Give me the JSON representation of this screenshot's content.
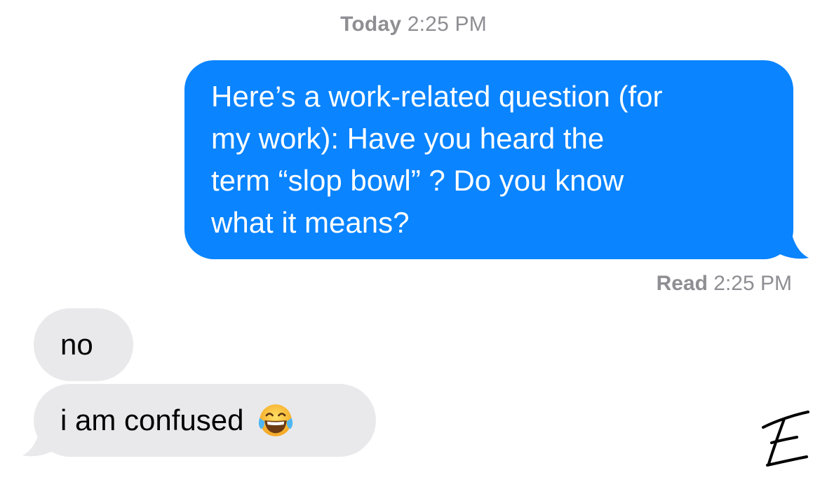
{
  "header": {
    "day": "Today",
    "time": "2:25 PM"
  },
  "messages": {
    "outgoing": {
      "text": "Here’s a work-related question (for my work): Have you heard the term “slop bowl” ? Do you know what it means?",
      "lines": [
        "Here’s a work-related question (for",
        "my work): Have you heard the",
        "term “slop bowl” ? Do you know",
        "what it means?"
      ]
    },
    "read_receipt": {
      "label": "Read",
      "time": "2:25 PM"
    },
    "incoming": [
      {
        "text": "no"
      },
      {
        "text": "i am confused",
        "emoji": "face-with-tears-of-joy-icon"
      }
    ]
  },
  "signature": {
    "text": "E"
  },
  "colors": {
    "outgoing_bubble": "#0a84ff",
    "incoming_bubble": "#e9e9eb",
    "meta_text": "#8e8e93"
  }
}
